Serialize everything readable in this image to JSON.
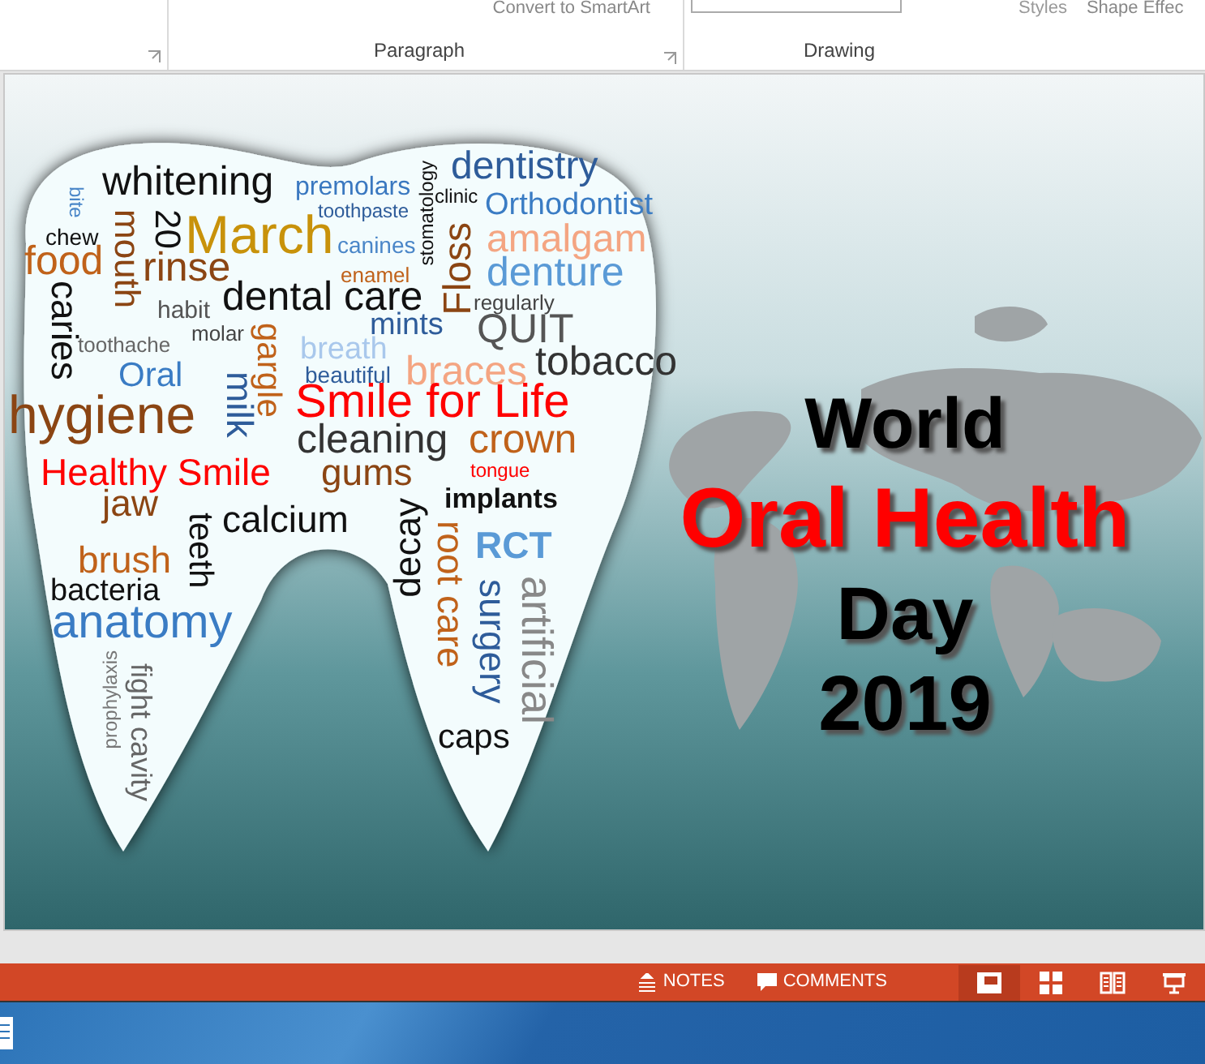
{
  "ribbon": {
    "convert_button": "Convert to SmartArt",
    "styles_button": "Styles",
    "shape_effects_button": "Shape Effec",
    "groups": [
      "Paragraph",
      "Drawing"
    ]
  },
  "slide": {
    "word_cloud": [
      {
        "text": "bite",
        "color": "#4a86c8"
      },
      {
        "text": "whitening",
        "color": "#111111"
      },
      {
        "text": "premolars",
        "color": "#3a78c0"
      },
      {
        "text": "chew",
        "color": "#111111"
      },
      {
        "text": "food",
        "color": "#c0621a"
      },
      {
        "text": "caries",
        "color": "#111111"
      },
      {
        "text": "mouth",
        "color": "#8b4513"
      },
      {
        "text": "20",
        "color": "#111111"
      },
      {
        "text": "March",
        "color": "#c8920a"
      },
      {
        "text": "toothpaste",
        "color": "#2e5c9a"
      },
      {
        "text": "canines",
        "color": "#4a86c8"
      },
      {
        "text": "rinse",
        "color": "#8b4513"
      },
      {
        "text": "enamel",
        "color": "#c0621a"
      },
      {
        "text": "stomatology",
        "color": "#111111"
      },
      {
        "text": "dentistry",
        "color": "#2e5c9a"
      },
      {
        "text": "clinic",
        "color": "#111111"
      },
      {
        "text": "Orthodontist",
        "color": "#3a7cc4"
      },
      {
        "text": "habit",
        "color": "#555555"
      },
      {
        "text": "dental care",
        "color": "#111111"
      },
      {
        "text": "Floss",
        "color": "#8b4513"
      },
      {
        "text": "amalgam",
        "color": "#f4a582"
      },
      {
        "text": "denture",
        "color": "#5a9ad6"
      },
      {
        "text": "regularly",
        "color": "#444444"
      },
      {
        "text": "toothache",
        "color": "#666666"
      },
      {
        "text": "molar",
        "color": "#444444"
      },
      {
        "text": "Oral",
        "color": "#3a7cc4"
      },
      {
        "text": "hygiene",
        "color": "#8b4513"
      },
      {
        "text": "milk",
        "color": "#2e5c9a"
      },
      {
        "text": "gargle",
        "color": "#c0621a"
      },
      {
        "text": "breath",
        "color": "#a9c8ec"
      },
      {
        "text": "mints",
        "color": "#2e5c9a"
      },
      {
        "text": "QUIT",
        "color": "#555555"
      },
      {
        "text": "beautiful",
        "color": "#2e5c9a"
      },
      {
        "text": "braces",
        "color": "#f4a582"
      },
      {
        "text": "tobacco",
        "color": "#333333"
      },
      {
        "text": "Smile for Life",
        "color": "#ff0000"
      },
      {
        "text": "cleaning",
        "color": "#333333"
      },
      {
        "text": "crown",
        "color": "#c0621a"
      },
      {
        "text": "Healthy Smile",
        "color": "#ff0000"
      },
      {
        "text": "gums",
        "color": "#8b4513"
      },
      {
        "text": "tongue",
        "color": "#ff0000"
      },
      {
        "text": "jaw",
        "color": "#8b4513"
      },
      {
        "text": "brush",
        "color": "#c0621a"
      },
      {
        "text": "bacteria",
        "color": "#111111"
      },
      {
        "text": "anatomy",
        "color": "#3a7cc4"
      },
      {
        "text": "teeth",
        "color": "#111111"
      },
      {
        "text": "calcium",
        "color": "#111111"
      },
      {
        "text": "decay",
        "color": "#111111"
      },
      {
        "text": "implants",
        "color": "#111111"
      },
      {
        "text": "prophylaxis",
        "color": "#777777"
      },
      {
        "text": "fight cavity",
        "color": "#666666"
      },
      {
        "text": "root care",
        "color": "#c0621a"
      },
      {
        "text": "RCT",
        "color": "#5a9ad6"
      },
      {
        "text": "caps",
        "color": "#111111"
      },
      {
        "text": "surgery",
        "color": "#2e5c9a"
      },
      {
        "text": "artificial",
        "color": "#888888"
      }
    ],
    "title_lines": [
      {
        "text": "World",
        "color": "#000000"
      },
      {
        "text": "Oral Health",
        "color": "#ff0000"
      },
      {
        "text": "Day",
        "color": "#000000"
      },
      {
        "text": "2019",
        "color": "#000000"
      }
    ]
  },
  "status_bar": {
    "notes_button": "NOTES",
    "comments_button": "COMMENTS",
    "views": [
      {
        "kind": "normal",
        "selected": true
      },
      {
        "kind": "sorter",
        "selected": false
      },
      {
        "kind": "reading",
        "selected": false
      },
      {
        "kind": "show",
        "selected": false
      }
    ]
  }
}
